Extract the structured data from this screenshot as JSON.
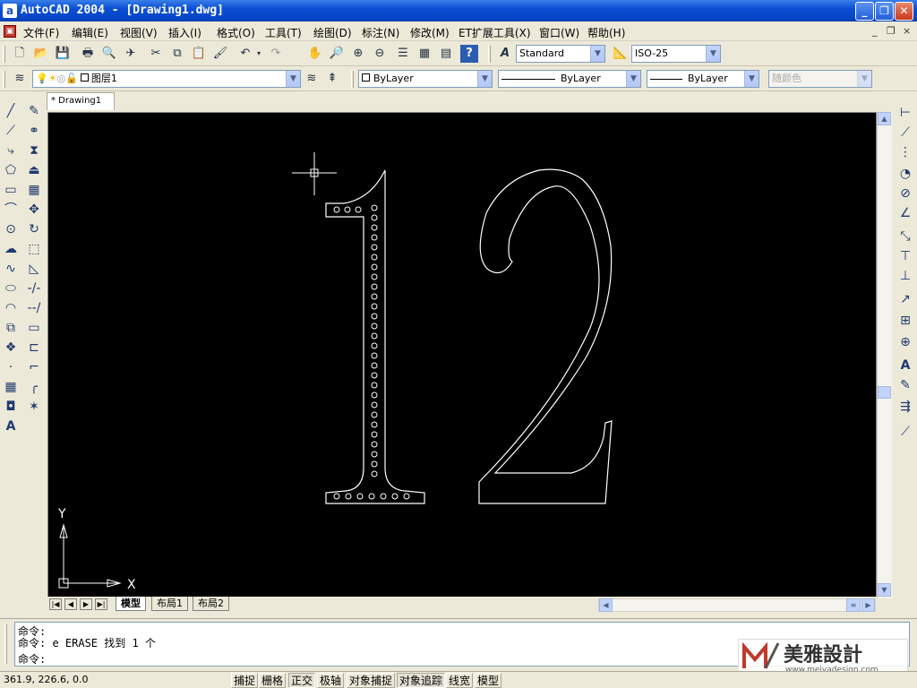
{
  "window": {
    "app_icon": "a",
    "title": "AutoCAD 2004 - [Drawing1.dwg]",
    "buttons": {
      "minimize": "_",
      "maximize": "❐",
      "close": "✕"
    }
  },
  "menu": {
    "items": [
      "文件(F)",
      "编辑(E)",
      "视图(V)",
      "插入(I)",
      "格式(O)",
      "工具(T)",
      "绘图(D)",
      "标注(N)",
      "修改(M)",
      "ET扩展工具(X)",
      "窗口(W)",
      "帮助(H)"
    ],
    "mdi_min": "_",
    "mdi_restore": "❐",
    "mdi_close": "×"
  },
  "toolbar": {
    "text_style": "Standard",
    "dim_style": "ISO-25"
  },
  "properties": {
    "layer": "图层1",
    "color": "ByLayer",
    "linetype": "ByLayer",
    "lineweight": "ByLayer",
    "plotstyle": "随颜色"
  },
  "document": {
    "tab": "* Drawing1"
  },
  "drawing": {
    "ucs_x": "X",
    "ucs_y": "Y"
  },
  "layout_tabs": [
    "模型",
    "布局1",
    "布局2"
  ],
  "command": {
    "lines": [
      "命令:",
      "命令: e ERASE 找到 1 个",
      "命令:"
    ]
  },
  "status": {
    "coordinates": "361.9, 226.6, 0.0",
    "buttons": [
      "捕捉",
      "栅格",
      "正交",
      "极轴",
      "对象捕捉",
      "对象追踪",
      "线宽",
      "模型"
    ],
    "pressed": [
      "正交",
      "对象追踪"
    ]
  },
  "watermark": {
    "brand": "美雅設計",
    "url": "www.meiyadesign.com"
  },
  "colors": {
    "title_blue": "#0a4fd4",
    "canvas": "#000000",
    "lines": "#ffffff"
  }
}
